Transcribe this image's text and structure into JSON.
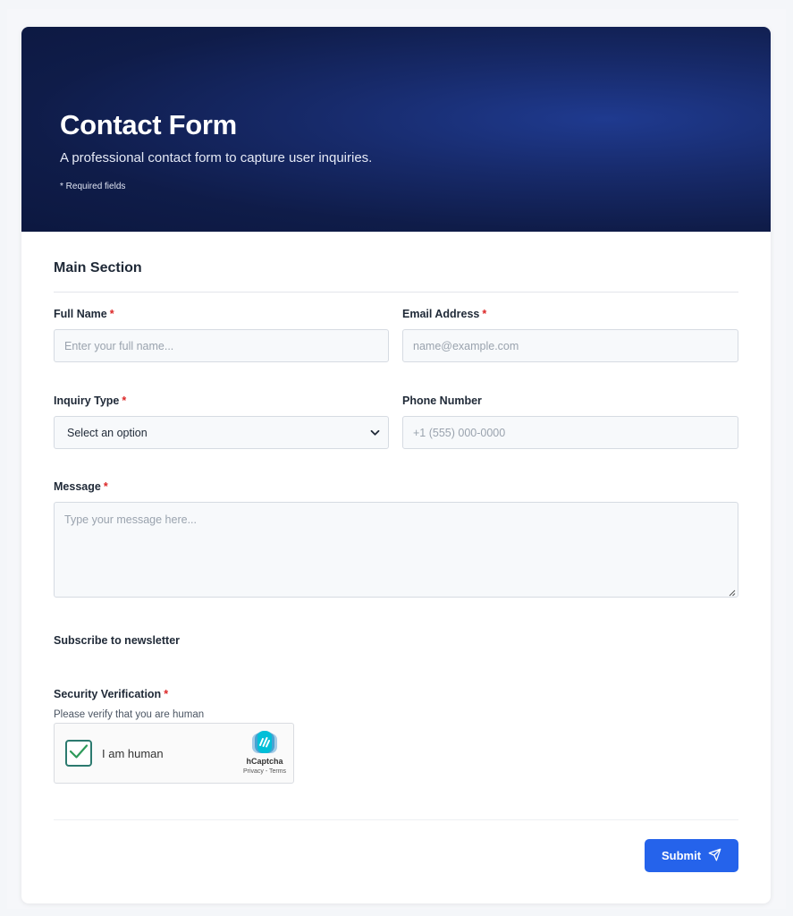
{
  "header": {
    "title": "Contact Form",
    "subtitle": "A professional contact form to capture user inquiries.",
    "required_note": "* Required fields"
  },
  "section": {
    "title": "Main Section"
  },
  "fields": {
    "full_name": {
      "label": "Full Name",
      "required": "*",
      "placeholder": "Enter your full name..."
    },
    "email": {
      "label": "Email Address",
      "required": "*",
      "placeholder": "name@example.com"
    },
    "inquiry_type": {
      "label": "Inquiry Type",
      "required": "*",
      "selected": "Select an option"
    },
    "phone": {
      "label": "Phone Number",
      "placeholder": "+1 (555) 000-0000"
    },
    "message": {
      "label": "Message",
      "required": "*",
      "placeholder": "Type your message here..."
    },
    "newsletter": {
      "label": "Subscribe to newsletter"
    },
    "security": {
      "label": "Security Verification",
      "required": "*",
      "help": "Please verify that you are human",
      "captcha_text": "I am human",
      "captcha_brand": "hCaptcha",
      "captcha_links": "Privacy - Terms",
      "checked": true
    }
  },
  "actions": {
    "submit_label": "Submit",
    "submit_icon": "send-icon"
  },
  "colors": {
    "accent": "#2563eb",
    "header_bg": "#0f1c49",
    "required": "#dc2626"
  }
}
